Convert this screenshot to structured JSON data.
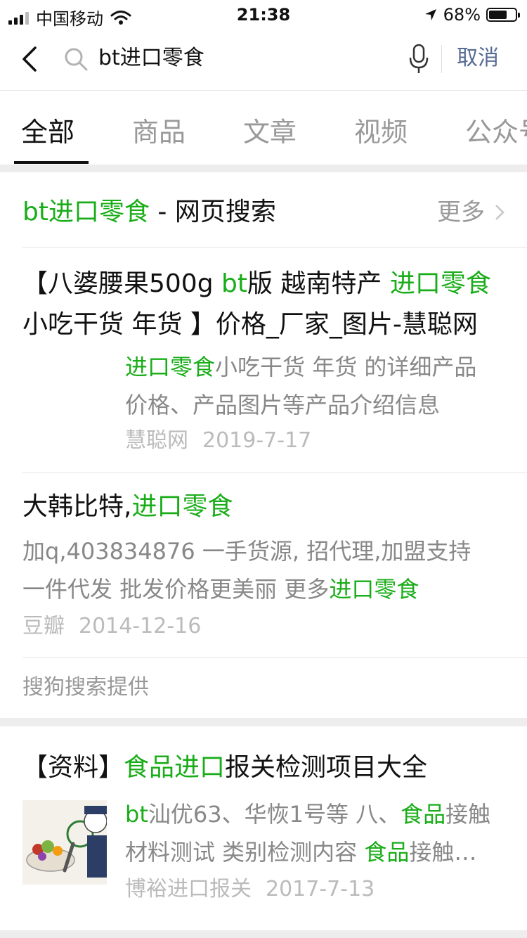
{
  "status": {
    "carrier": "中国移动",
    "time": "21:38",
    "battery": "68%",
    "battery_level": 0.68
  },
  "search": {
    "query": "bt进口零食",
    "cancel_label": "取消"
  },
  "tabs": [
    {
      "label": "全部",
      "active": true
    },
    {
      "label": "商品",
      "active": false
    },
    {
      "label": "文章",
      "active": false
    },
    {
      "label": "视频",
      "active": false
    },
    {
      "label": "公众号",
      "active": false
    }
  ],
  "web_section": {
    "keyword": "bt进口零食",
    "suffix": " - 网页搜索",
    "more_label": "更多",
    "provider": "搜狗搜索提供",
    "results": [
      {
        "title_parts": [
          {
            "text": "【八婆腰果500g ",
            "hl": false
          },
          {
            "text": "bt",
            "hl": true
          },
          {
            "text": "版 越南特产 ",
            "hl": false
          },
          {
            "text": "进口零食",
            "hl": true
          },
          {
            "text": "小吃干货 年货 】价格_厂家_图片-慧聪网",
            "hl": false
          }
        ],
        "desc_parts": [
          {
            "text": "进口零食",
            "hl": true
          },
          {
            "text": "小吃干货 年货 的详细产品价格、产品图片等产品介绍信息",
            "hl": false
          }
        ],
        "source": "慧聪网",
        "date": "2019-7-17"
      },
      {
        "title_parts": [
          {
            "text": "大韩比特,",
            "hl": false
          },
          {
            "text": "进口零食",
            "hl": true
          }
        ],
        "desc_parts": [
          {
            "text": "加q,403834876 一手货源, 招代理,加盟支持一件代发 批发价格更美丽 更多",
            "hl": false
          },
          {
            "text": "进口零食",
            "hl": true
          }
        ],
        "source": "豆瓣",
        "date": "2014-12-16"
      }
    ]
  },
  "article": {
    "title_parts": [
      {
        "text": "【资料】",
        "hl": false
      },
      {
        "text": "食品进口",
        "hl": true
      },
      {
        "text": "报关检测项目大全",
        "hl": false
      }
    ],
    "desc_parts": [
      {
        "text": "bt",
        "hl": true
      },
      {
        "text": "汕优63、华恢1号等 八、",
        "hl": false
      },
      {
        "text": "食品",
        "hl": true
      },
      {
        "text": "接触材料测试 类别检测内容 ",
        "hl": false
      },
      {
        "text": "食品",
        "hl": true
      },
      {
        "text": "接触材料测试",
        "hl": false
      }
    ],
    "source": "博裕进口报关",
    "date": "2017-7-13"
  }
}
